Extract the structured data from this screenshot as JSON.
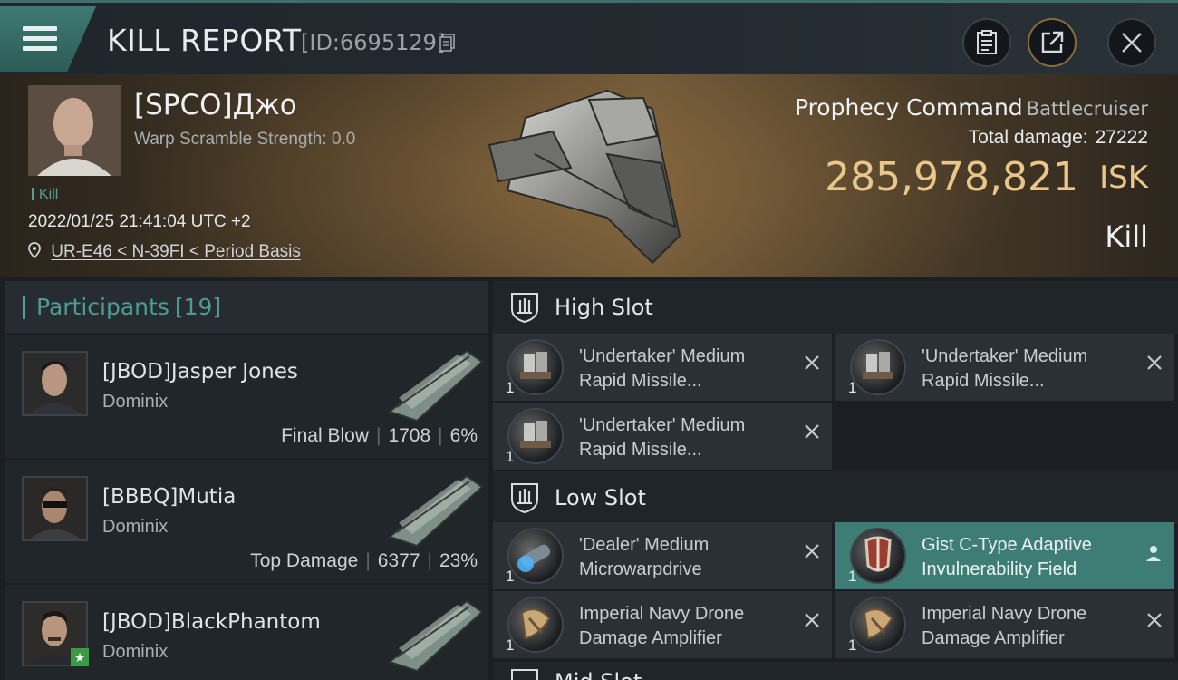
{
  "header": {
    "title": "KILL REPORT",
    "report_id": "[ID:6695129]"
  },
  "victim": {
    "name": "[SPCO]Джо",
    "warp_scramble": "Warp Scramble Strength: 0.0",
    "tag": "Kill",
    "datetime": "2022/01/25 21:41:04 UTC +2",
    "location": "UR-E46 < N-39FI < Period Basis",
    "ship_name": "Prophecy Command",
    "ship_class": "Battlecruiser",
    "total_damage_label": "Total damage:",
    "total_damage_value": "27222",
    "isk_value": "285,978,821",
    "isk_unit": "ISK",
    "result": "Kill"
  },
  "participants": {
    "label": "Participants",
    "count": "[19]",
    "items": [
      {
        "name": "[JBOD]Jasper Jones",
        "ship": "Dominix",
        "role": "Final Blow",
        "damage": "1708",
        "percent": "6%"
      },
      {
        "name": "[BBBQ]Mutia",
        "ship": "Dominix",
        "role": "Top Damage",
        "damage": "6377",
        "percent": "23%"
      },
      {
        "name": "[JBOD]BlackPhantom",
        "ship": "Dominix",
        "role": "",
        "damage": "",
        "percent": ""
      }
    ]
  },
  "slots": {
    "high": {
      "label": "High Slot",
      "modules": [
        {
          "name": "'Undertaker' Medium Rapid Missile...",
          "qty": "1"
        },
        {
          "name": "'Undertaker' Medium Rapid Missile...",
          "qty": "1"
        },
        {
          "name": "'Undertaker' Medium Rapid Missile...",
          "qty": "1"
        }
      ]
    },
    "low": {
      "label": "Low Slot",
      "modules": [
        {
          "name": "'Dealer' Medium Microwarpdrive",
          "qty": "1"
        },
        {
          "name": "Gist C-Type Adaptive Invulnerability Field",
          "qty": "1"
        },
        {
          "name": "Imperial Navy Drone Damage Amplifier",
          "qty": "1"
        },
        {
          "name": "Imperial Navy Drone Damage Amplifier",
          "qty": "1"
        }
      ]
    },
    "mid": {
      "label": "Mid Slot"
    }
  },
  "icons": {
    "menu": "menu-icon",
    "copy": "copy-icon",
    "clipboard": "clipboard-icon",
    "share": "share-icon",
    "close": "close-icon",
    "location": "location-pin-icon",
    "destroyed": "close-icon",
    "dropped": "person-icon"
  },
  "colors": {
    "accent": "#4fa39a",
    "isk": "#e9c78a",
    "active_module": "#3d7d76"
  }
}
